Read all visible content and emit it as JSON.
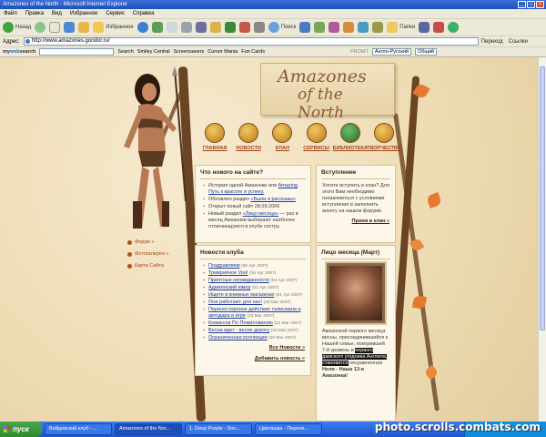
{
  "window": {
    "title": "Amazones of the North - Microsoft Internet Explorer"
  },
  "menu": [
    "Файл",
    "Правка",
    "Вид",
    "Избранное",
    "Сервис",
    "Справка"
  ],
  "toolbar": {
    "back": "Назад",
    "favorites": "Избранное",
    "search": "Поиск",
    "folders": "Папки"
  },
  "address": {
    "label": "Адрес:",
    "url": "http://www.amazones.gondor.ru/",
    "go": "Переход",
    "links": "Ссылки"
  },
  "search_toolbar": {
    "brand_prefix": "my",
    "brand_web": "web",
    "brand_suffix": "search",
    "search_btn": "Search",
    "smiley": "Smiley Central",
    "screensavers": "Screensavers",
    "cursor": "Cursor Mania",
    "funcards": "Fun Cards",
    "promt": "PROMT",
    "lang": "Англо-Русский",
    "topic": "Общий"
  },
  "site": {
    "title_line1": "Amazones",
    "title_line2": "of the North",
    "nav": [
      "ГЛАВНАЯ",
      "НОВОСТИ",
      "КЛАН",
      "СЕРВИСЫ",
      "БИБЛИОТЕКА",
      "ТВОРЧЕСТВО"
    ],
    "side_links": [
      "Форум »",
      "Фотогалерея »",
      "Карта Сайта"
    ]
  },
  "whats_new": {
    "title": "Что нового на сайте?",
    "items": [
      {
        "text": "История одной Амазонки или ",
        "link": "Amazing Путь к красоте и успеху."
      },
      {
        "text": "Обновлен раздел ",
        "link": "«Были и рассказы»"
      },
      {
        "text": "Открыт новый сайт 28.09.2006",
        "link": ""
      },
      {
        "text": "Новый раздел ",
        "link": "«Лицо месяца»",
        "tail": " — раз в месяц Амазонки выбирают наиболее отличающуюся в клубе сестру."
      }
    ]
  },
  "join": {
    "title": "Вступление",
    "text": "Хотите вступить в клан? Для этого Вам необходимо ознакомиться с условиями вступления и заполнить анкету на нашем форуме.",
    "more": "Прием в клан »"
  },
  "club_news": {
    "title": "Новости клуба",
    "items": [
      {
        "link": "Поздравляем",
        "date": "(06 Apr 2007)"
      },
      {
        "link": "Трижрапное Ура!",
        "date": "(06 Apr 2007)"
      },
      {
        "link": "Приятные неожиданности",
        "date": "(04 Apr 2007)"
      },
      {
        "link": "Адмиянский юмор",
        "date": "(02 Apr 2007)"
      },
      {
        "link": "Ищете в книжных магазинах",
        "date": "(01 Apr 2007)"
      },
      {
        "link": "Они работают для нас!",
        "date": "(29 Mar 2007)"
      },
      {
        "link": "Переносторонне действие талисмана и автодара в игре",
        "date": "(23 Mar 2007)"
      },
      {
        "link": "Комиксов По Помилованию",
        "date": "(23 Mar 2007)"
      },
      {
        "link": "Весна идет - весне дорогу",
        "date": "(22 Mar 2007)"
      },
      {
        "link": "Ограниченная коллекция",
        "date": "(20 Mar 2007)"
      }
    ],
    "all_news": "Все Новости »",
    "add_news": "Добавить новость »"
  },
  "face": {
    "title": "Лицо месяца (Март)",
    "text": "Амазонкой первого месяца весны, присоединившейся к Нашей семье, покорившей 7-й уровень и ",
    "highlight": "первого дамского угодника Англела, становится",
    "tail": " несравненная ",
    "name": "Неля - Наша 13-я Амазонка!"
  },
  "taskbar": {
    "start": "пуск",
    "tasks": [
      "Войдовский клуб - ...",
      "Amazones of the Nor...",
      "1. Deep Purple - Sno...",
      "Цветашка - Перепи..."
    ],
    "watermark": "photo.scrolls.combats.com"
  },
  "colors": {
    "accent": "#a3441b",
    "link": "#1c3c9c",
    "parchment": "#f0e2c0",
    "xp_blue": "#1f55d0"
  }
}
